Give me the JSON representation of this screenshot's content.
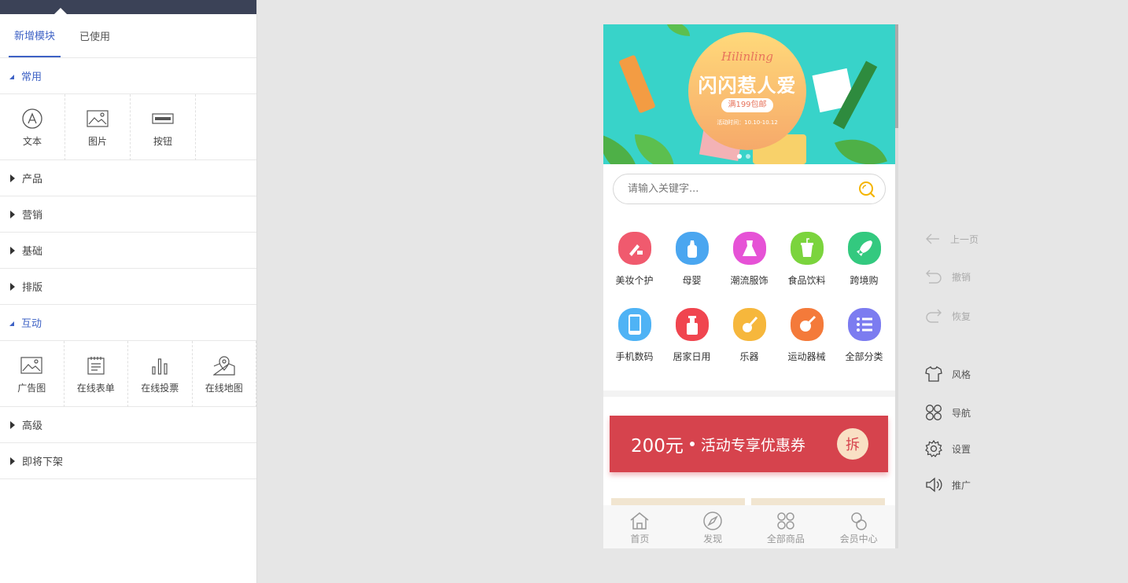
{
  "editor": {
    "tabs": [
      {
        "label": "新增模块",
        "active": true
      },
      {
        "label": "已使用",
        "active": false
      }
    ],
    "sections": {
      "common": {
        "title": "常用",
        "items": [
          {
            "label": "文本",
            "icon": "text-icon"
          },
          {
            "label": "图片",
            "icon": "image-icon"
          },
          {
            "label": "按钮",
            "icon": "button-icon"
          }
        ]
      },
      "product": {
        "title": "产品"
      },
      "marketing": {
        "title": "营销"
      },
      "basic": {
        "title": "基础"
      },
      "layout": {
        "title": "排版"
      },
      "interactive": {
        "title": "互动",
        "items": [
          {
            "label": "广告图",
            "icon": "ad-image-icon"
          },
          {
            "label": "在线表单",
            "icon": "form-icon"
          },
          {
            "label": "在线投票",
            "icon": "vote-chart-icon"
          },
          {
            "label": "在线地图",
            "icon": "map-icon"
          }
        ]
      },
      "advanced": {
        "title": "高级"
      },
      "delisting": {
        "title": "即将下架"
      }
    }
  },
  "preview": {
    "banner": {
      "brand": "Hilinling",
      "headline": "闪闪惹人爱",
      "promo": "满199包邮",
      "date": "活动时间：10.10-10.12"
    },
    "search": {
      "placeholder": "请输入关键字..."
    },
    "categories": [
      {
        "label": "美妆个护",
        "color": "#f05a6e",
        "icon": "lipstick-icon"
      },
      {
        "label": "母婴",
        "color": "#4aa6f0",
        "icon": "baby-bottle-icon"
      },
      {
        "label": "潮流服饰",
        "color": "#e652d6",
        "icon": "dress-icon"
      },
      {
        "label": "食品饮料",
        "color": "#7bd43d",
        "icon": "drink-icon"
      },
      {
        "label": "跨境购",
        "color": "#33c97f",
        "icon": "rocket-icon"
      },
      {
        "label": "手机数码",
        "color": "#4fb3f5",
        "icon": "phone-icon"
      },
      {
        "label": "居家日用",
        "color": "#f0454f",
        "icon": "bottle-icon"
      },
      {
        "label": "乐器",
        "color": "#f6b73c",
        "icon": "guitar-icon"
      },
      {
        "label": "运动器械",
        "color": "#f47a3a",
        "icon": "ball-icon"
      },
      {
        "label": "全部分类",
        "color": "#7c7cf0",
        "icon": "list-icon"
      }
    ],
    "coupon": {
      "amount": "200元",
      "description": "活动专享优惠券",
      "action": "拆"
    },
    "bottom_nav": [
      {
        "label": "首页",
        "icon": "home-icon"
      },
      {
        "label": "发现",
        "icon": "compass-icon"
      },
      {
        "label": "全部商品",
        "icon": "grid-icon"
      },
      {
        "label": "会员中心",
        "icon": "member-icon"
      }
    ]
  },
  "toolbar": {
    "prev_page": "上一页",
    "undo": "撤销",
    "redo": "恢复",
    "style": "风格",
    "navigation": "导航",
    "settings": "设置",
    "promote": "推广"
  },
  "colors": {
    "accent": "#3e62c5",
    "dark_bar": "#3b4257",
    "coupon_red": "#d6434d",
    "banner_teal": "#38d3c9"
  }
}
